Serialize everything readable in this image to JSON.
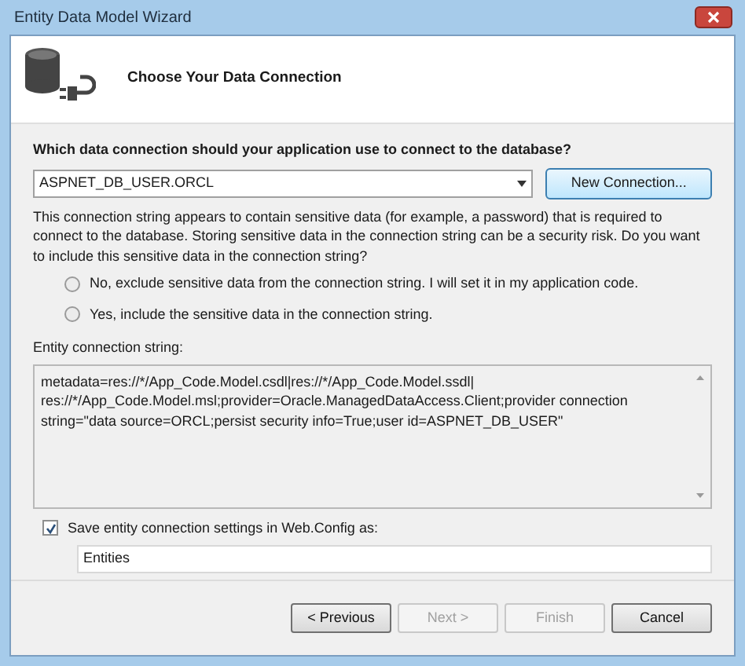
{
  "window": {
    "title": "Entity Data Model Wizard"
  },
  "header": {
    "title": "Choose Your Data Connection"
  },
  "question": "Which data connection should your application use to connect to the database?",
  "connection": {
    "value": "ASPNET_DB_USER.ORCL"
  },
  "new_connection_button": "New Connection...",
  "warning": "This connection string appears to contain sensitive data (for example, a password) that is required to connect to the database. Storing sensitive data in the connection string can be a security risk. Do you want to include this sensitive data in the connection string?",
  "options": [
    {
      "label": "No, exclude sensitive data from the connection string. I will set it in my application code.",
      "selected": false
    },
    {
      "label": "Yes, include the sensitive data in the connection string.",
      "selected": false
    }
  ],
  "connection_string": {
    "label": "Entity connection string:",
    "lines": [
      "metadata=res://*/App_Code.Model.csdl|res://*/App_Code.Model.ssdl|",
      "res://*/App_Code.Model.msl;provider=Oracle.ManagedDataAccess.Client;provider connection",
      "string=\"data source=ORCL;persist security info=True;user id=ASPNET_DB_USER\""
    ]
  },
  "save_setting": {
    "label": "Save entity connection settings in Web.Config as:",
    "checked": true,
    "value": "Entities"
  },
  "buttons": [
    {
      "label": "< Previous",
      "disabled": false
    },
    {
      "label": "Next >",
      "disabled": true
    },
    {
      "label": "Finish",
      "disabled": true
    },
    {
      "label": "Cancel",
      "disabled": false
    }
  ]
}
